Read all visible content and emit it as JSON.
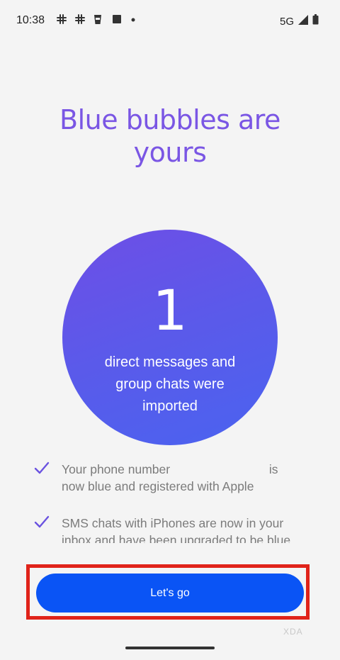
{
  "status_bar": {
    "time": "10:38",
    "network": "5G",
    "icons_left": [
      "slack-icon",
      "slack-icon",
      "cup-icon",
      "square-icon",
      "dot-icon"
    ],
    "icons_right": [
      "signal-icon",
      "battery-icon"
    ]
  },
  "screen": {
    "title": "Blue bubbles are yours",
    "imported_count": "1",
    "imported_description": "direct messages and group chats were imported",
    "check_items": [
      {
        "icon": "check-icon",
        "text_before": "Your phone number",
        "text_after": "is now blue and registered with Apple"
      },
      {
        "icon": "check-icon",
        "text": "SMS chats with iPhones are now in your inbox and have been upgraded to be blue bubbles"
      }
    ],
    "cta_label": "Let's go"
  },
  "watermark": "XDA",
  "colors": {
    "title": "#7a56e4",
    "circle_start": "#6e4ee6",
    "circle_end": "#4a63f0",
    "button": "#0a54f5",
    "highlight": "#e0231a",
    "check": "#6a52e0"
  }
}
